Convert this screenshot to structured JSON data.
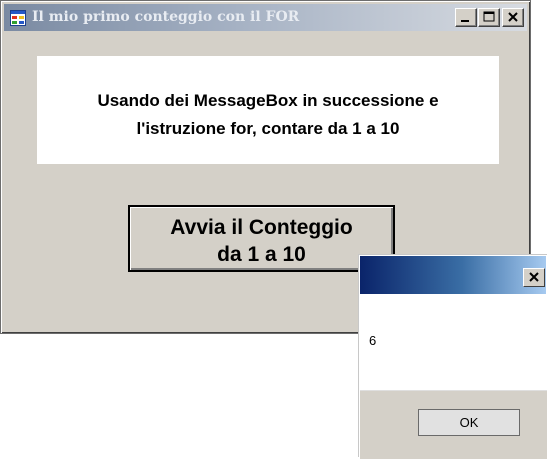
{
  "window": {
    "title": "Il mio primo conteggio con il FOR",
    "icon": "app-window-icon",
    "controls": [
      "minimize-icon",
      "maximize-icon",
      "close-icon"
    ]
  },
  "info_panel": {
    "line1": "Usando dei MessageBox in successione e",
    "line2": "l'istruzione for, contare da 1 a 10"
  },
  "count_button": {
    "line1": "Avvia il Conteggio",
    "line2": "da 1 a 10"
  },
  "message_box": {
    "title": "",
    "text": "6",
    "ok_label": "OK",
    "close_icon": "close-icon"
  },
  "colors": {
    "window_face": "#d4d0c8",
    "title_bar_inactive": "#7a8aa2",
    "msgbox_title_active": "#0a246a",
    "panel_background": "#ffffff"
  }
}
